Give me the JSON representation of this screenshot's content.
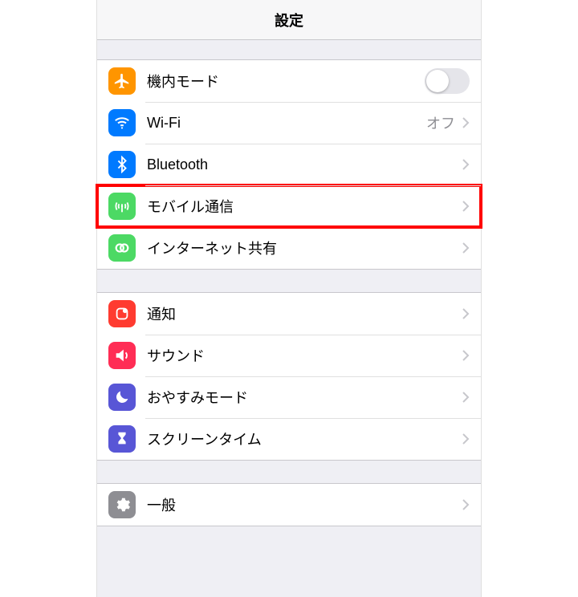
{
  "header": {
    "title": "設定"
  },
  "groups": [
    {
      "rows": [
        {
          "id": "airplane",
          "label": "機内モード",
          "control": "toggle",
          "toggle_on": false,
          "icon": "airplane-icon",
          "icon_bg": "#ff9500"
        },
        {
          "id": "wifi",
          "label": "Wi-Fi",
          "value": "オフ",
          "control": "disclosure",
          "icon": "wifi-icon",
          "icon_bg": "#007aff"
        },
        {
          "id": "bluetooth",
          "label": "Bluetooth",
          "control": "disclosure",
          "icon": "bluetooth-icon",
          "icon_bg": "#007aff"
        },
        {
          "id": "cellular",
          "label": "モバイル通信",
          "control": "disclosure",
          "icon": "cellular-icon",
          "icon_bg": "#4cd964",
          "highlighted": true
        },
        {
          "id": "hotspot",
          "label": "インターネット共有",
          "control": "disclosure",
          "icon": "hotspot-icon",
          "icon_bg": "#4cd964"
        }
      ]
    },
    {
      "rows": [
        {
          "id": "notifications",
          "label": "通知",
          "control": "disclosure",
          "icon": "notifications-icon",
          "icon_bg": "#ff3b30"
        },
        {
          "id": "sounds",
          "label": "サウンド",
          "control": "disclosure",
          "icon": "sounds-icon",
          "icon_bg": "#ff2d55"
        },
        {
          "id": "dnd",
          "label": "おやすみモード",
          "control": "disclosure",
          "icon": "moon-icon",
          "icon_bg": "#5856d6"
        },
        {
          "id": "screentime",
          "label": "スクリーンタイム",
          "control": "disclosure",
          "icon": "hourglass-icon",
          "icon_bg": "#5856d6"
        }
      ]
    },
    {
      "rows": [
        {
          "id": "general",
          "label": "一般",
          "control": "disclosure",
          "icon": "gear-icon",
          "icon_bg": "#8e8e93"
        }
      ]
    }
  ]
}
